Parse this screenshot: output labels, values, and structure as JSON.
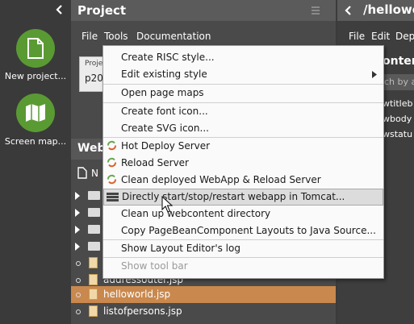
{
  "launcher": {
    "collapse_icon": "chevron-left-icon",
    "items": [
      {
        "label": "New project...",
        "icon": "new-document-icon"
      },
      {
        "label": "Screen map...",
        "icon": "map-icon"
      }
    ]
  },
  "project_panel": {
    "title": "Project",
    "menu_icon": "hamburger-icon",
    "menubar": [
      "File",
      "Tools",
      "Documentation"
    ],
    "field_label": "Proje",
    "field_value": "p20",
    "web_section_title": "Web",
    "new_label": "N",
    "tree": [
      {
        "type": "folder"
      },
      {
        "type": "folder"
      },
      {
        "type": "folder"
      },
      {
        "type": "folder"
      },
      {
        "type": "folder"
      },
      {
        "type": "file",
        "name": ""
      },
      {
        "type": "file",
        "name": "addressouter.jsp"
      },
      {
        "type": "file",
        "name": "helloworld.jsp",
        "selected": true
      },
      {
        "type": "file",
        "name": "listofpersons.jsp"
      }
    ]
  },
  "right_panel": {
    "back_icon": "chevron-left-icon",
    "title": "/hellowo",
    "menubar": [
      "File",
      "Edit",
      "Dep"
    ],
    "section_title": "ontent",
    "search_placeholder": "ch by att",
    "items": [
      "wtitleb",
      "wbody",
      "wstatu"
    ]
  },
  "tools_menu": {
    "items": [
      {
        "label": "Create RISC style...",
        "group": 0
      },
      {
        "label": "Edit existing style",
        "group": 0,
        "submenu": true
      },
      {
        "label": "Open page maps",
        "group": 1
      },
      {
        "label": "Create font icon...",
        "group": 2
      },
      {
        "label": "Create SVG icon...",
        "group": 2
      },
      {
        "label": "Hot Deploy Server",
        "group": 3,
        "icon": "reload-icon"
      },
      {
        "label": "Reload Server",
        "group": 3,
        "icon": "reload-icon"
      },
      {
        "label": "Clean deployed WebApp & Reload Server",
        "group": 3,
        "icon": "reload-icon"
      },
      {
        "label": "Directly start/stop/restart webapp in Tomcat...",
        "group": 4,
        "icon": "server-icon",
        "highlighted": true
      },
      {
        "label": "Clean up webcontent directory",
        "group": 4
      },
      {
        "label": "Copy PageBeanComponent Layouts to Java Source...",
        "group": 4
      },
      {
        "label": "Show Layout Editor's log",
        "group": 5
      },
      {
        "label": "Show tool bar",
        "group": 5,
        "disabled": true
      }
    ]
  },
  "colors": {
    "accent_green": "#5a9a33",
    "selection": "#c9884d",
    "reload_orange": "#d9622b",
    "reload_green": "#6aa84f"
  }
}
